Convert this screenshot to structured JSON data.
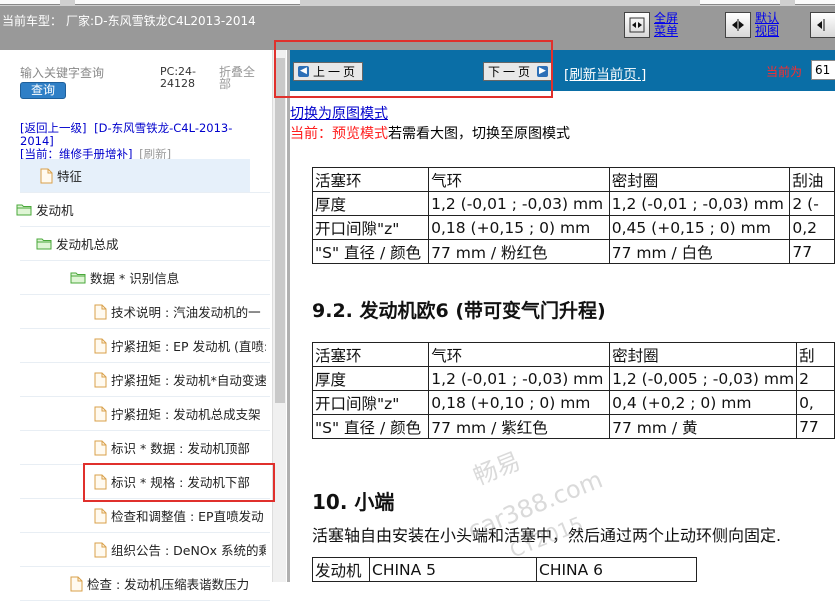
{
  "header": {
    "vehicle_label": "当前车型：",
    "vehicle_value": "厂家:D-东风雪铁龙C4L2013-2014",
    "buttons": [
      {
        "label": "全屏菜单",
        "icon": "fullscreen-icon"
      },
      {
        "label": "默认视图",
        "icon": "default-view-icon"
      }
    ]
  },
  "search": {
    "placeholder": "输入关键字查询",
    "button_label": "查询",
    "pc_code": "PC:24-24128",
    "collapse_all": "折叠全部"
  },
  "breadcrumb": {
    "back": "[返回上一级]",
    "manufacturer": "[D-东风雪铁龙-C4L-2013-2014]",
    "current": "[当前：维修手册增补]",
    "refresh": "[刷新]"
  },
  "tree": [
    {
      "label": "特征",
      "type": "doc"
    },
    {
      "label": "发动机",
      "type": "folder"
    },
    {
      "label": "发动机总成",
      "type": "folder"
    },
    {
      "label": "数据 * 识别信息",
      "type": "folder"
    },
    {
      "label": "技术说明 : 汽油发动机的一",
      "type": "doc"
    },
    {
      "label": "拧紧扭矩 : EP 发动机 (直喷:",
      "type": "doc"
    },
    {
      "label": "拧紧扭矩 : 发动机*自动变速",
      "type": "doc"
    },
    {
      "label": "拧紧扭矩 : 发动机总成支架",
      "type": "doc"
    },
    {
      "label": "标识 * 数据 : 发动机顶部",
      "type": "doc"
    },
    {
      "label": "标识 * 规格 : 发动机下部",
      "type": "doc"
    },
    {
      "label": "检查和调整值 : EP直喷发动",
      "type": "doc"
    },
    {
      "label": "组织公告 : DeNOx 系统的剩",
      "type": "doc"
    },
    {
      "label": "检查 : 发动机压缩表谐数压力",
      "type": "doc"
    }
  ],
  "viewer": {
    "prev_page": "上一页",
    "next_page": "下一页",
    "refresh_page": "[刷新当前页.]",
    "current_page_label": "当前为",
    "current_page_value": "61",
    "original_mode_link": "切换为原图模式",
    "preview_label": "当前：预览模式",
    "preview_hint": "若需看大图，切换至原图模式"
  },
  "document": {
    "table1": {
      "header": [
        "活塞环",
        "气环",
        "密封圈",
        "刮油"
      ],
      "rows": [
        [
          "厚度",
          "1,2 (-0,01 ; -0,03) mm",
          "1,2 (-0,01 ; -0,03) mm",
          "2 (-"
        ],
        [
          "开口间隙\"z\"",
          "0,18 (+0,15 ; 0) mm",
          "0,45 (+0,15 ; 0) mm",
          "0,2"
        ],
        [
          "\"S\" 直径 / 颜色",
          "77 mm / 粉红色",
          "77 mm / 白色",
          "77"
        ]
      ]
    },
    "heading_92": "9.2. 发动机欧6 (带可变气门升程)",
    "table2": {
      "header": [
        "活塞环",
        "气环",
        "密封圈",
        "刮"
      ],
      "rows": [
        [
          "厚度",
          "1,2 (-0,01 ; -0,03) mm",
          "1,2 (-0,005 ; -0,03) mm",
          "2"
        ],
        [
          "开口间隙\"z\"",
          "0,18 (+0,10 ; 0) mm",
          "0,4 (+0,2 ; 0) mm",
          "0,"
        ],
        [
          "\"S\" 直径 / 颜色",
          "77 mm / 紫红色",
          "77 mm / 黄",
          "77"
        ]
      ]
    },
    "heading_10": "10. 小端",
    "paragraph": "活塞轴自由安装在小头端和活塞中，然后通过两个止动环侧向固定.",
    "table3": {
      "row": [
        "发动机",
        "CHINA 5",
        "CHINA 6"
      ]
    },
    "watermark": [
      "畅易",
      "car388.com",
      "CY2015"
    ]
  }
}
